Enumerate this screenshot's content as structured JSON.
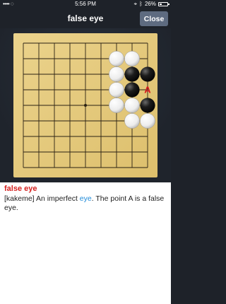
{
  "status_bar": {
    "carrier": "•••• ◌",
    "time": "5:56 PM",
    "battery": "26%",
    "battery_level": 0.26
  },
  "header": {
    "title": "false eye",
    "close_label": "Close"
  },
  "board": {
    "size": 9,
    "annotation": "A",
    "annotation_point": [
      8,
      3
    ],
    "black_stones": [
      [
        7,
        2
      ],
      [
        8,
        2
      ],
      [
        7,
        3
      ],
      [
        8,
        4
      ]
    ],
    "white_stones": [
      [
        6,
        1
      ],
      [
        7,
        1
      ],
      [
        6,
        2
      ],
      [
        6,
        3
      ],
      [
        6,
        4
      ],
      [
        7,
        4
      ],
      [
        7,
        5
      ],
      [
        8,
        5
      ]
    ],
    "colors": {
      "wood": "#e4c97c",
      "line": "#2a2113",
      "annotation": "#d6191f"
    }
  },
  "definition": {
    "term": "false eye",
    "prefix": "[kakeme] An imperfect ",
    "link_text": "eye",
    "suffix": ". The point A is a false eye."
  }
}
